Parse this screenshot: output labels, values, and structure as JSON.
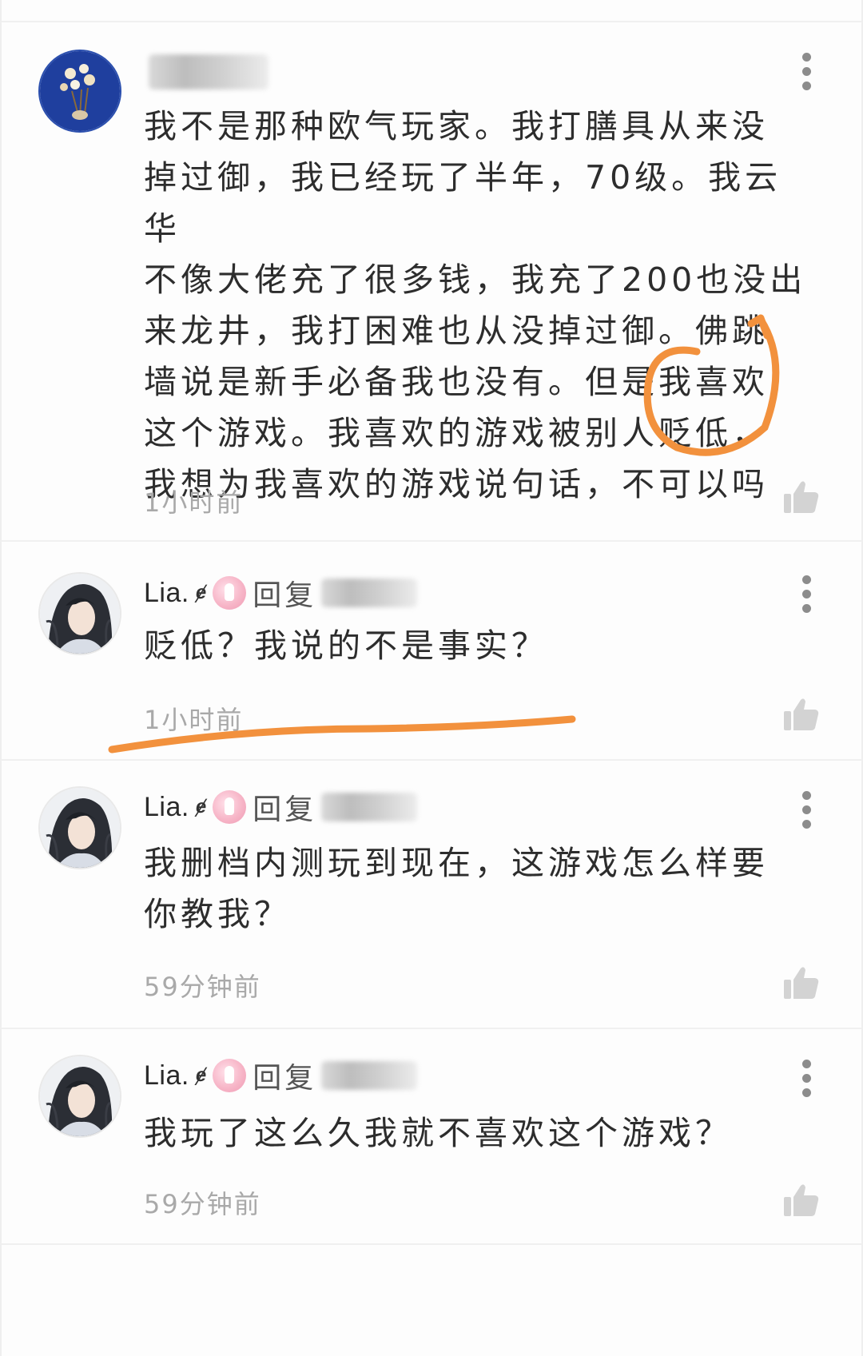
{
  "comments": [
    {
      "username": "",
      "is_reply": false,
      "reply_label": "",
      "content": "我不是那种欧气玩家。我打膳具从来没\n掉过御，我已经玩了半年，70级。我云华\n不像大佬充了很多钱，我充了200也没出\n来龙井，我打困难也从没掉过御。佛跳\n墙说是新手必备我也没有。但是我喜欢\n这个游戏。我喜欢的游戏被别人贬低，\n我想为我喜欢的游戏说句话，不可以吗",
      "timestamp": "1小时前"
    },
    {
      "username": "Lia.",
      "level_glyph": "ɇ",
      "is_reply": true,
      "reply_label": "回复",
      "content": "贬低？我说的不是事实？",
      "timestamp": "1小时前"
    },
    {
      "username": "Lia.",
      "level_glyph": "ɇ",
      "is_reply": true,
      "reply_label": "回复",
      "content": "我删档内测玩到现在，这游戏怎么样要\n你教我？",
      "timestamp": "59分钟前"
    },
    {
      "username": "Lia.",
      "level_glyph": "ɇ",
      "is_reply": true,
      "reply_label": "回复",
      "content": "我玩了这么久我就不喜欢这个游戏？",
      "timestamp": "59分钟前"
    }
  ],
  "icons": {
    "more": "more-vertical-icon",
    "like": "thumbs-up-icon",
    "badge": "rabbit-badge-icon",
    "level": "level-icon"
  },
  "colors": {
    "annotation_orange": "#f2913d",
    "timestamp_gray": "#a9a9a9",
    "divider": "#f0f0f0"
  }
}
